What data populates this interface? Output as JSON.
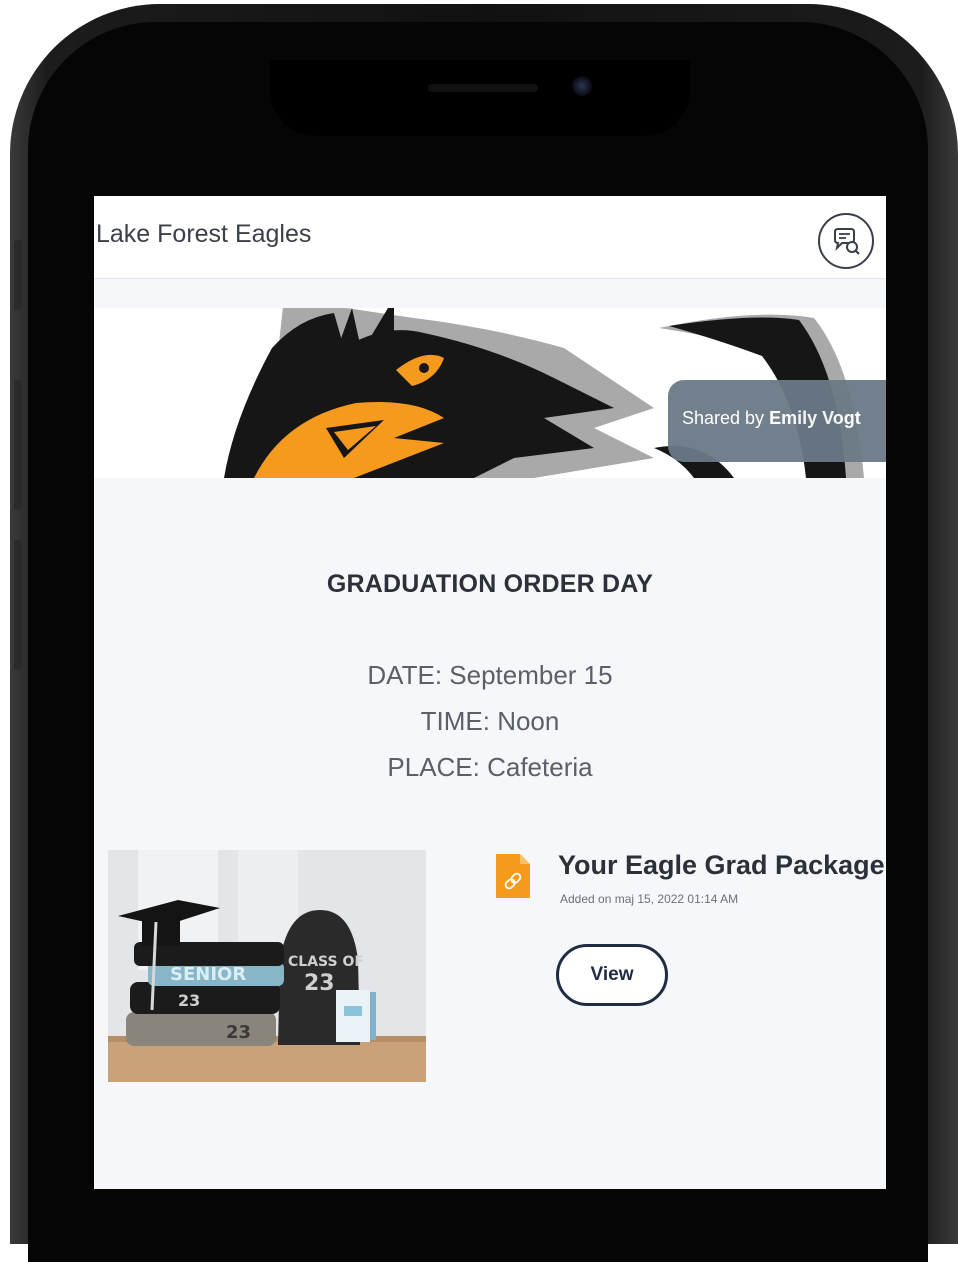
{
  "app": {
    "title": "Lake Forest Eagles",
    "chat_icon": "chat-bubble-icon"
  },
  "banner": {
    "image": "eagle-mascot-logo",
    "shared_prefix": "Shared by ",
    "shared_by": "Emily Vogt"
  },
  "post": {
    "title": "GRADUATION ORDER DAY",
    "date": "DATE: September 15",
    "time": "TIME: Noon",
    "place": "PLACE: Cafeteria"
  },
  "attachment": {
    "thumbnail": "graduation-merchandise-photo",
    "file_icon": "link-file-icon",
    "name": "Your Eagle Grad Package",
    "added": "Added on maj 15, 2022 01:14 AM",
    "view_label": "View"
  },
  "colors": {
    "accent_orange": "#f59a1d",
    "button_navy": "#1f2c44",
    "pill_gray": "#6a7a86",
    "screen_bg": "#f6f7fa"
  }
}
